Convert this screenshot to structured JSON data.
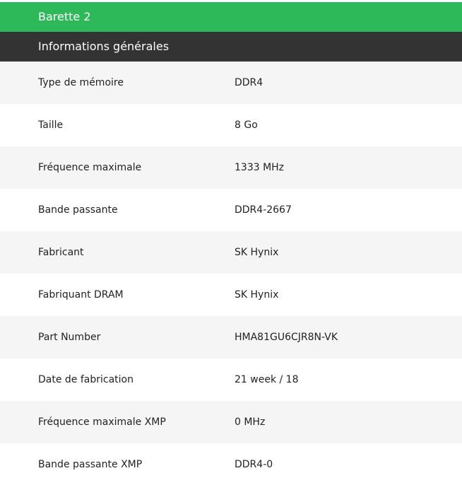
{
  "section_title": "Barette 2",
  "subsection_title": "Informations générales",
  "rows": [
    {
      "label": "Type de mémoire",
      "value": "DDR4"
    },
    {
      "label": "Taille",
      "value": "8 Go"
    },
    {
      "label": "Fréquence maximale",
      "value": "1333 MHz"
    },
    {
      "label": "Bande passante",
      "value": "DDR4-2667"
    },
    {
      "label": "Fabricant",
      "value": "SK Hynix"
    },
    {
      "label": "Fabriquant DRAM",
      "value": "SK Hynix"
    },
    {
      "label": "Part Number",
      "value": "HMA81GU6CJR8N-VK"
    },
    {
      "label": "Date de fabrication",
      "value": "21 week / 18"
    },
    {
      "label": "Fréquence maximale XMP",
      "value": "0 MHz"
    },
    {
      "label": "Bande passante XMP",
      "value": "DDR4-0"
    }
  ],
  "colors": {
    "section_header_bg": "#2db85a",
    "subsection_header_bg": "#333333",
    "row_alt_bg": "#f5f5f5"
  }
}
